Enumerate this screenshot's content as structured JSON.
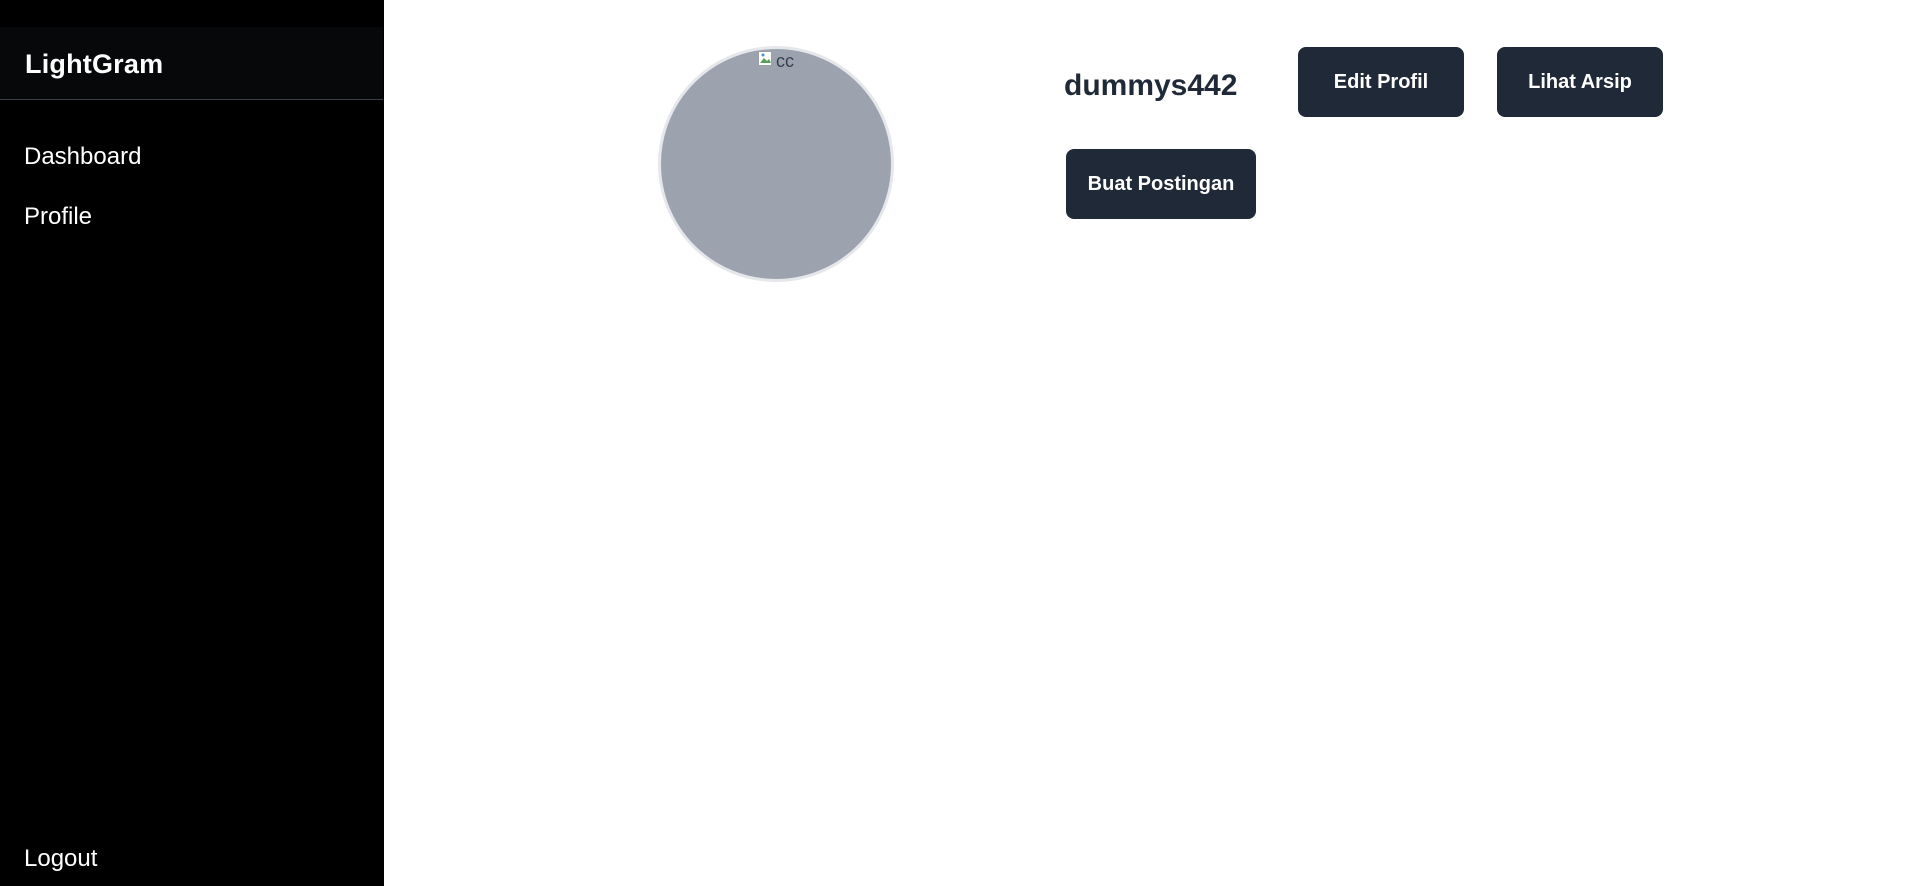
{
  "sidebar": {
    "brand": "LightGram",
    "items": [
      {
        "label": "Dashboard"
      },
      {
        "label": "Profile"
      }
    ],
    "logout_label": "Logout"
  },
  "profile": {
    "username": "dummys442",
    "avatar_alt": "cc",
    "avatar_bg": "#9ca3af",
    "buttons": {
      "edit": "Edit Profil",
      "archive": "Lihat Arsip",
      "create_post": "Buat Postingan"
    }
  },
  "colors": {
    "sidebar_bg": "#000000",
    "button_bg": "#1f2937",
    "username_color": "#1f2937"
  }
}
